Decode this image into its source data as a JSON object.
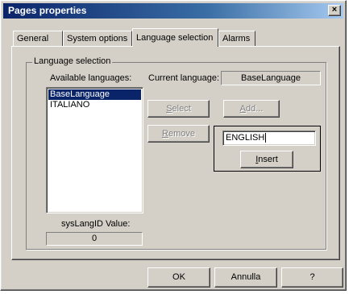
{
  "window": {
    "title": "Pages properties",
    "close_glyph": "×"
  },
  "tabs": [
    {
      "label": "General"
    },
    {
      "label": "System options"
    },
    {
      "label": "Language selection"
    },
    {
      "label": "Alarms"
    }
  ],
  "group": {
    "legend": "Language selection",
    "available_label": "Available languages:",
    "languages": [
      "BaseLanguage",
      "ITALIANO"
    ],
    "selected_language": "BaseLanguage",
    "current_language_label": "Current language:",
    "current_language_value": "BaseLanguage",
    "select_button": "Select",
    "add_button": "Add...",
    "remove_button": "Remove",
    "new_language_value": "ENGLISH",
    "insert_button": "Insert",
    "syslang_label": "sysLangID Value:",
    "syslang_value": "0"
  },
  "footer": {
    "ok": "OK",
    "cancel": "Annulla",
    "help": "?"
  }
}
